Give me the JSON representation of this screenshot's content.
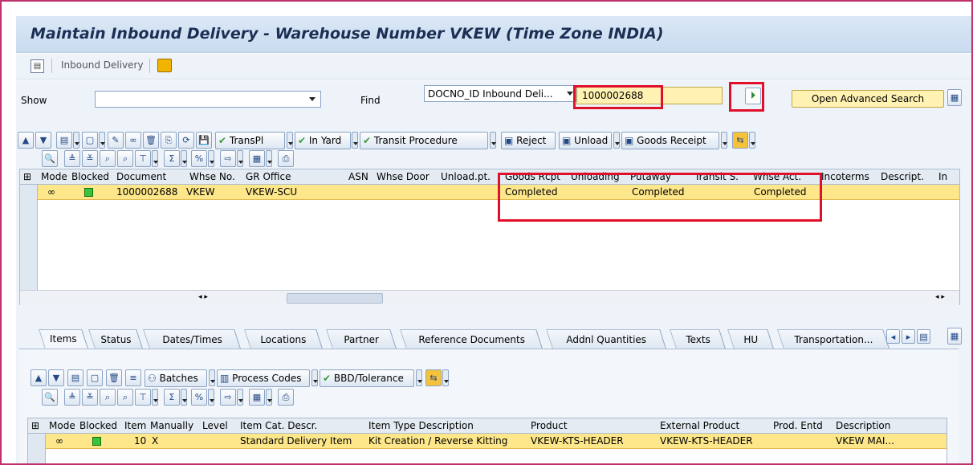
{
  "title": "Maintain Inbound Delivery - Warehouse Number VKEW (Time Zone INDIA)",
  "menu": {
    "item": "Inbound Delivery"
  },
  "search": {
    "show_label": "Show",
    "show_value": "",
    "find_label": "Find",
    "find_type": "DOCNO_ID Inbound Deli...",
    "find_value": "1000002688",
    "advanced_label": "Open Advanced Search"
  },
  "toolbar1": {
    "transpl": "TransPl",
    "in_yard": "In Yard",
    "transit_procedure": "Transit Procedure",
    "reject": "Reject",
    "unload": "Unload",
    "goods_receipt": "Goods Receipt"
  },
  "header_table": {
    "columns": [
      "Mode",
      "Blocked",
      "Document",
      "Whse No.",
      "GR Office",
      "ASN",
      "Whse Door",
      "Unload.pt.",
      "Goods Rcpt",
      "Unloading",
      "Putaway",
      "Transit S.",
      "Whse Act.",
      "Incoterms",
      "Descript.",
      "In"
    ],
    "row": {
      "document": "1000002688",
      "whse_no": "VKEW",
      "gr_office": "VKEW-SCU",
      "goods_rcpt": "Completed",
      "putaway": "Completed",
      "whse_act": "Completed"
    }
  },
  "tabs": [
    "Items",
    "Status",
    "Dates/Times",
    "Locations",
    "Partner",
    "Reference Documents",
    "Addnl Quantities",
    "Texts",
    "HU",
    "Transportation..."
  ],
  "toolbar2": {
    "batches": "Batches",
    "process_codes": "Process Codes",
    "bbd_tolerance": "BBD/Tolerance"
  },
  "items_table": {
    "columns": [
      "Mode",
      "Blocked",
      "Item",
      "Manually",
      "Level",
      "Item Cat. Descr.",
      "Item Type Description",
      "Product",
      "External Product",
      "Prod. Entd",
      "Description"
    ],
    "row": {
      "item": "10",
      "manually": "X",
      "item_cat": "Standard Delivery Item",
      "item_type": "Kit Creation / Reverse Kitting",
      "product": "VKEW-KTS-HEADER",
      "external_product": "VKEW-KTS-HEADER",
      "description": "VKEW MAI..."
    }
  },
  "colors": {
    "accent": "#e0102a",
    "row_highlight": "#fde78a",
    "title_text": "#1b2f55"
  }
}
